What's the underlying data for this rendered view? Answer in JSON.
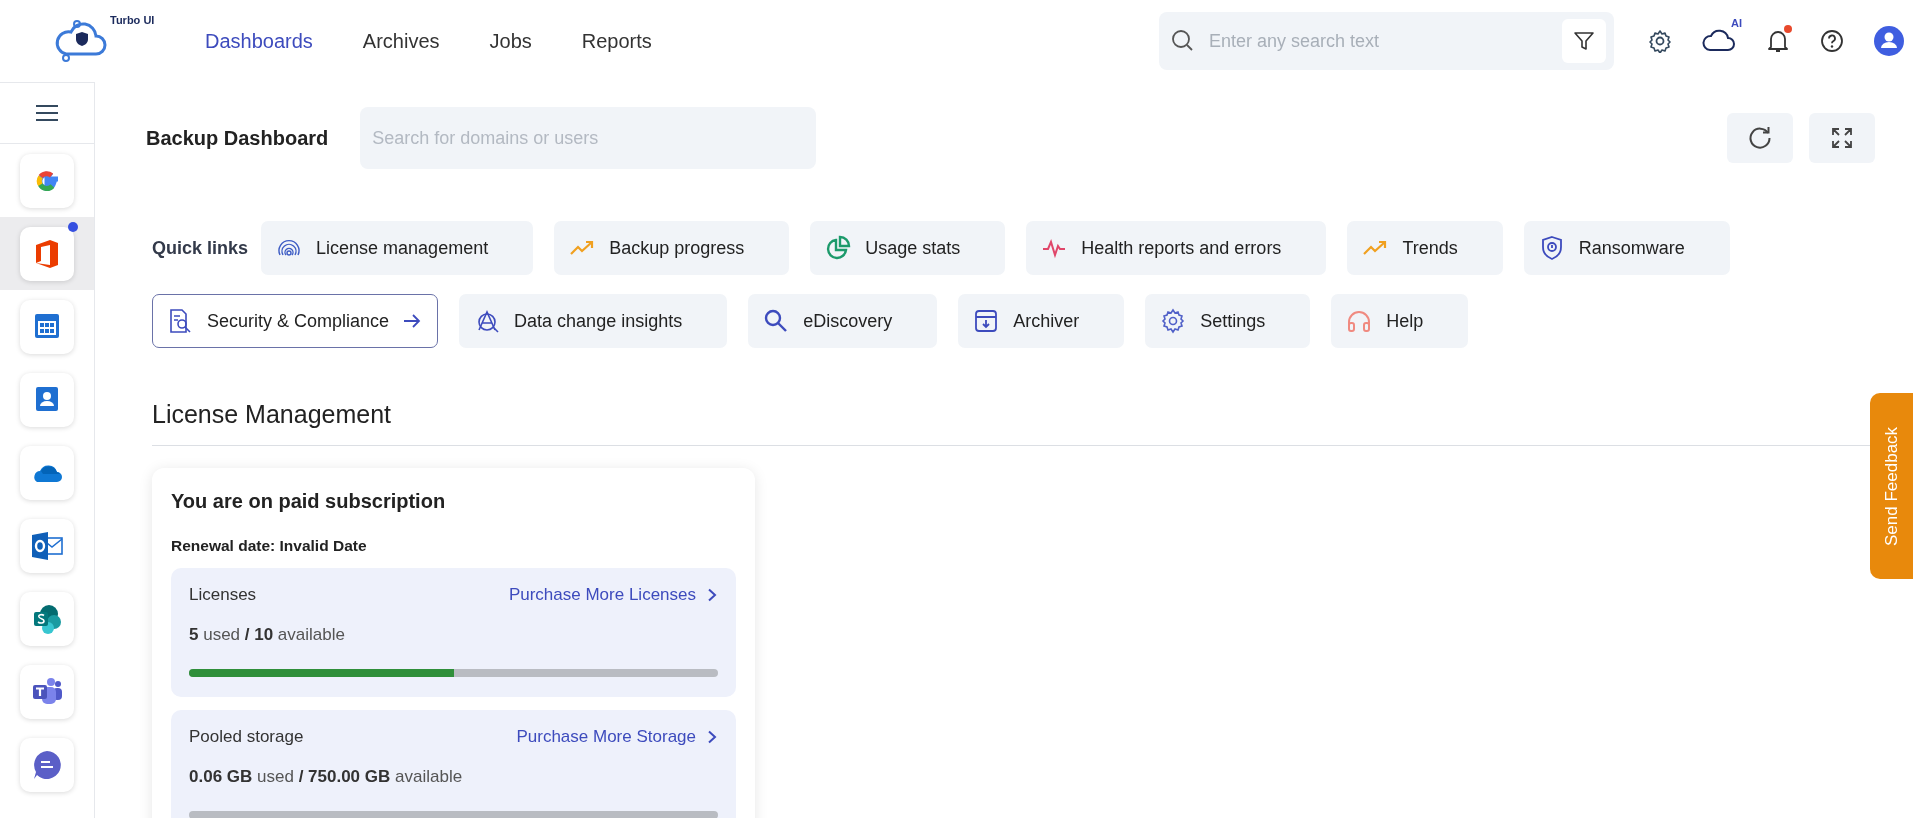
{
  "header": {
    "logo_text": "Turbo UI",
    "nav": [
      {
        "label": "Dashboards",
        "selected": true
      },
      {
        "label": "Archives",
        "selected": false
      },
      {
        "label": "Jobs",
        "selected": false
      },
      {
        "label": "Reports",
        "selected": false
      }
    ],
    "search": {
      "placeholder": "Enter any search text"
    },
    "ai_badge": "AI",
    "notifications_unread": true
  },
  "sidebar": {
    "items": [
      {
        "selected": false,
        "notify": false
      },
      {
        "selected": true,
        "notify": true
      },
      {
        "selected": false,
        "notify": false
      },
      {
        "selected": false,
        "notify": false
      },
      {
        "selected": false,
        "notify": false
      },
      {
        "selected": false,
        "notify": false
      },
      {
        "selected": false,
        "notify": false
      },
      {
        "selected": false,
        "notify": false
      },
      {
        "selected": false,
        "notify": false
      }
    ]
  },
  "dashboard": {
    "title": "Backup Dashboard",
    "search": {
      "placeholder": "Search for domains or users"
    }
  },
  "quick_links": {
    "label": "Quick links",
    "links": [
      {
        "label": "License management",
        "selected": false
      },
      {
        "label": "Backup progress",
        "selected": false
      },
      {
        "label": "Usage stats",
        "selected": false
      },
      {
        "label": "Health reports and errors",
        "selected": false
      },
      {
        "label": "Trends",
        "selected": false
      },
      {
        "label": "Ransomware",
        "selected": false
      },
      {
        "label": "Security & Compliance",
        "selected": true
      },
      {
        "label": "Data change insights",
        "selected": false
      },
      {
        "label": "eDiscovery",
        "selected": false
      },
      {
        "label": "Archiver",
        "selected": false
      },
      {
        "label": "Settings",
        "selected": false
      },
      {
        "label": "Help",
        "selected": false
      }
    ]
  },
  "section": {
    "title": "License Management"
  },
  "subscription": {
    "title": "You are on paid subscription",
    "renewal": "Renewal date: Invalid Date",
    "panels": [
      {
        "title": "Licenses",
        "action": "Purchase More Licenses",
        "usage": "**5** used **/ 10** available",
        "level": 0.5
      },
      {
        "title": "Pooled storage",
        "action": "Purchase More Storage",
        "usage": "**0.06 GB** used **/ 750.00 GB** available",
        "level": 0
      }
    ]
  },
  "feedback": {
    "label": "Send Feedback"
  }
}
